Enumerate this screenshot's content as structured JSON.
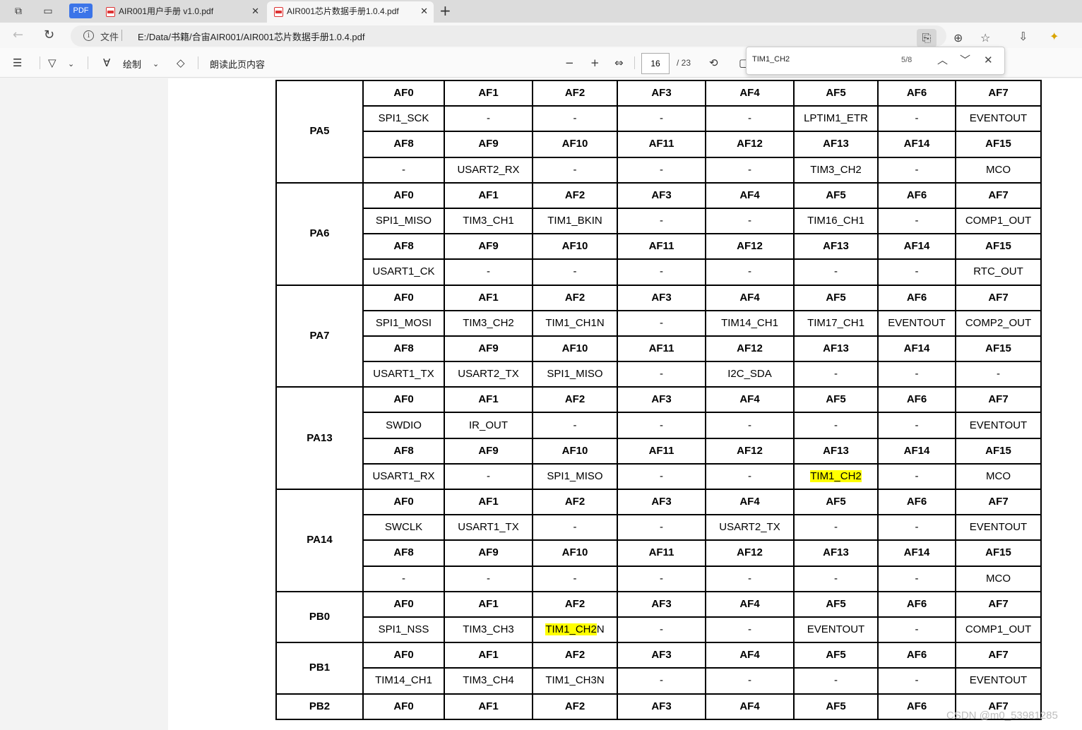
{
  "browser": {
    "pdf_badge": "PDF",
    "tabs": [
      {
        "label": "AIR001用户手册 v1.0.pdf",
        "close": "✕"
      },
      {
        "label": "AIR001芯片数据手册1.0.4.pdf",
        "close": "✕"
      }
    ],
    "new_tab": "+",
    "address": {
      "file_label": "文件",
      "path": "E:/Data/书籍/合宙AIR001/AIR001芯片数据手册1.0.4.pdf"
    }
  },
  "toolbar": {
    "draw_label": "绘制",
    "read_aloud_label": "朗读此页内容",
    "current_page": "16",
    "total_pages": "/ 23"
  },
  "find": {
    "query": "TIM1_CH2",
    "count": "5/8"
  },
  "watermark": "CSDN @m0_53981285",
  "af_table": {
    "highlight_text": "TIM1_CH2",
    "pins": [
      {
        "pin": "PA5",
        "rows": [
          {
            "h": true,
            "c": [
              "AF0",
              "AF1",
              "AF2",
              "AF3",
              "AF4",
              "AF5",
              "AF6",
              "AF7"
            ]
          },
          {
            "h": false,
            "c": [
              "SPI1_SCK",
              "-",
              "-",
              "-",
              "-",
              "LPTIM1_ETR",
              "-",
              "EVENTOUT"
            ]
          },
          {
            "h": true,
            "c": [
              "AF8",
              "AF9",
              "AF10",
              "AF11",
              "AF12",
              "AF13",
              "AF14",
              "AF15"
            ]
          },
          {
            "h": false,
            "c": [
              "-",
              "USART2_RX",
              "-",
              "-",
              "-",
              "TIM3_CH2",
              "-",
              "MCO"
            ]
          }
        ]
      },
      {
        "pin": "PA6",
        "rows": [
          {
            "h": true,
            "c": [
              "AF0",
              "AF1",
              "AF2",
              "AF3",
              "AF4",
              "AF5",
              "AF6",
              "AF7"
            ]
          },
          {
            "h": false,
            "c": [
              "SPI1_MISO",
              "TIM3_CH1",
              "TIM1_BKIN",
              "-",
              "-",
              "TIM16_CH1",
              "-",
              "COMP1_OUT"
            ]
          },
          {
            "h": true,
            "c": [
              "AF8",
              "AF9",
              "AF10",
              "AF11",
              "AF12",
              "AF13",
              "AF14",
              "AF15"
            ]
          },
          {
            "h": false,
            "c": [
              "USART1_CK",
              "-",
              "-",
              "-",
              "-",
              "-",
              "-",
              "RTC_OUT"
            ]
          }
        ]
      },
      {
        "pin": "PA7",
        "rows": [
          {
            "h": true,
            "c": [
              "AF0",
              "AF1",
              "AF2",
              "AF3",
              "AF4",
              "AF5",
              "AF6",
              "AF7"
            ]
          },
          {
            "h": false,
            "c": [
              "SPI1_MOSI",
              "TIM3_CH2",
              "TIM1_CH1N",
              "-",
              "TIM14_CH1",
              "TIM17_CH1",
              "EVENTOUT",
              "COMP2_OUT"
            ]
          },
          {
            "h": true,
            "c": [
              "AF8",
              "AF9",
              "AF10",
              "AF11",
              "AF12",
              "AF13",
              "AF14",
              "AF15"
            ]
          },
          {
            "h": false,
            "c": [
              "USART1_TX",
              "USART2_TX",
              "SPI1_MISO",
              "-",
              "I2C_SDA",
              "-",
              "-",
              "-"
            ]
          }
        ]
      },
      {
        "pin": "PA13",
        "rows": [
          {
            "h": true,
            "c": [
              "AF0",
              "AF1",
              "AF2",
              "AF3",
              "AF4",
              "AF5",
              "AF6",
              "AF7"
            ]
          },
          {
            "h": false,
            "c": [
              "SWDIO",
              "IR_OUT",
              "-",
              "-",
              "-",
              "-",
              "-",
              "EVENTOUT"
            ]
          },
          {
            "h": true,
            "c": [
              "AF8",
              "AF9",
              "AF10",
              "AF11",
              "AF12",
              "AF13",
              "AF14",
              "AF15"
            ]
          },
          {
            "h": false,
            "c": [
              "USART1_RX",
              "-",
              "SPI1_MISO",
              "-",
              "-",
              "TIM1_CH2",
              "-",
              "MCO"
            ]
          }
        ]
      },
      {
        "pin": "PA14",
        "rows": [
          {
            "h": true,
            "c": [
              "AF0",
              "AF1",
              "AF2",
              "AF3",
              "AF4",
              "AF5",
              "AF6",
              "AF7"
            ]
          },
          {
            "h": false,
            "c": [
              "SWCLK",
              "USART1_TX",
              "-",
              "-",
              "USART2_TX",
              "-",
              "-",
              "EVENTOUT"
            ]
          },
          {
            "h": true,
            "c": [
              "AF8",
              "AF9",
              "AF10",
              "AF11",
              "AF12",
              "AF13",
              "AF14",
              "AF15"
            ]
          },
          {
            "h": false,
            "c": [
              "-",
              "-",
              "-",
              "-",
              "-",
              "-",
              "-",
              "MCO"
            ]
          }
        ]
      },
      {
        "pin": "PB0",
        "rows": [
          {
            "h": true,
            "c": [
              "AF0",
              "AF1",
              "AF2",
              "AF3",
              "AF4",
              "AF5",
              "AF6",
              "AF7"
            ]
          },
          {
            "h": false,
            "c": [
              "SPI1_NSS",
              "TIM3_CH3",
              "TIM1_CH2N",
              "-",
              "-",
              "EVENTOUT",
              "-",
              "COMP1_OUT"
            ]
          }
        ]
      },
      {
        "pin": "PB1",
        "rows": [
          {
            "h": true,
            "c": [
              "AF0",
              "AF1",
              "AF2",
              "AF3",
              "AF4",
              "AF5",
              "AF6",
              "AF7"
            ]
          },
          {
            "h": false,
            "c": [
              "TIM14_CH1",
              "TIM3_CH4",
              "TIM1_CH3N",
              "-",
              "-",
              "-",
              "-",
              "EVENTOUT"
            ]
          }
        ]
      },
      {
        "pin": "PB2",
        "rows": [
          {
            "h": true,
            "c": [
              "AF0",
              "AF1",
              "AF2",
              "AF3",
              "AF4",
              "AF5",
              "AF6",
              "AF7"
            ]
          }
        ]
      }
    ]
  }
}
